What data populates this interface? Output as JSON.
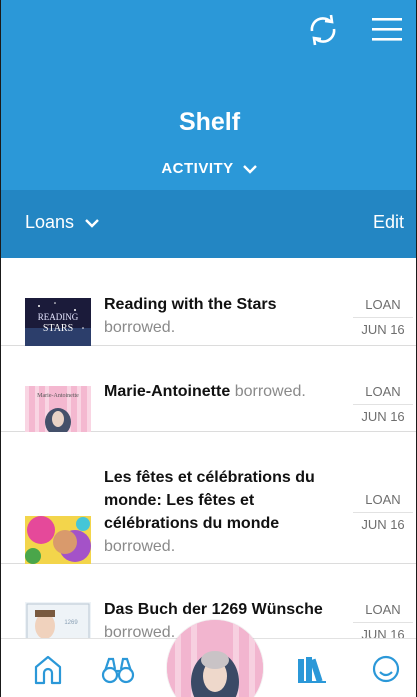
{
  "header": {
    "title": "Shelf",
    "activity_label": "ACTIVITY",
    "sync_icon": "sync-icon",
    "menu_icon": "hamburger-menu-icon",
    "color": "#2b98d8"
  },
  "subbar": {
    "filter_label": "Loans",
    "edit_label": "Edit",
    "color": "#2386c3"
  },
  "loans": [
    {
      "title": "Reading with the Stars",
      "status": "borrowed.",
      "type": "LOAN",
      "date": "JUN 16"
    },
    {
      "title": "Marie-Antoinette",
      "status": "borrowed.",
      "type": "LOAN",
      "date": "JUN 16"
    },
    {
      "title": "Les fêtes et célébrations du monde: Les fêtes et célébrations du monde",
      "status": "borrowed.",
      "type": "LOAN",
      "date": "JUN 16"
    },
    {
      "title": "Das Buch der 1269 Wünsche",
      "status": "borrowed.",
      "type": "LOAN",
      "date": "JUN 16"
    }
  ],
  "tabbar": {
    "tabs": [
      "home-icon",
      "binoculars-icon",
      "now-reading-cover",
      "shelf-books-icon",
      "smiley-face-icon"
    ],
    "active_color": "#2b98d8"
  }
}
